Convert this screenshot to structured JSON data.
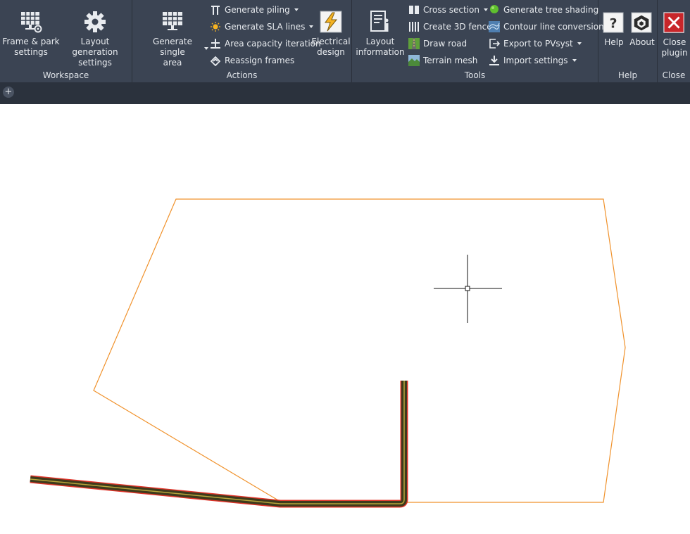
{
  "ribbon": {
    "panels": {
      "workspace": "Workspace",
      "actions": "Actions",
      "tools": "Tools",
      "help": "Help",
      "close": "Close"
    },
    "workspace": {
      "frame_park": "Frame & park\nsettings",
      "layout_gen": "Layout generation\nsettings"
    },
    "actions": {
      "generate_single": "Generate single\narea",
      "generate_piling": "Generate piling",
      "generate_sla": "Generate SLA lines",
      "area_capacity": "Area capacity iteration",
      "reassign_frames": "Reassign frames",
      "electrical": "Electrical\ndesign"
    },
    "tools": {
      "layout_info": "Layout\ninformation",
      "cross_section": "Cross section",
      "create_fence": "Create 3D fence",
      "draw_road": "Draw road",
      "terrain_mesh": "Terrain mesh",
      "tree_shading": "Generate tree shading",
      "contour": "Contour line conversion",
      "export_pvsyst": "Export to PVsyst",
      "import_settings": "Import settings"
    },
    "help": {
      "help": "Help",
      "about": "About"
    },
    "close": {
      "close_plugin": "Close\nplugin"
    }
  },
  "tabstrip": {
    "add_tab": "+"
  },
  "colors": {
    "ribbon_bg": "#3b4453",
    "tab_bg": "#2b323d",
    "boundary": "#f0922c",
    "road_fill": "#3f3a1c",
    "road_edge": "#e0342a",
    "close_red": "#c8262a",
    "tree_green": "#5fbf2e",
    "bolt_yellow": "#f5b323"
  },
  "icons": {
    "frame_park": "solar-panel-gear-icon",
    "layout_gen": "gear-icon",
    "generate_single": "solar-panel-icon",
    "electrical": "lightning-bolt-icon",
    "layout_info": "document-info-icon",
    "help": "question-mark-icon",
    "about": "logo-icon",
    "close": "close-x-icon"
  }
}
